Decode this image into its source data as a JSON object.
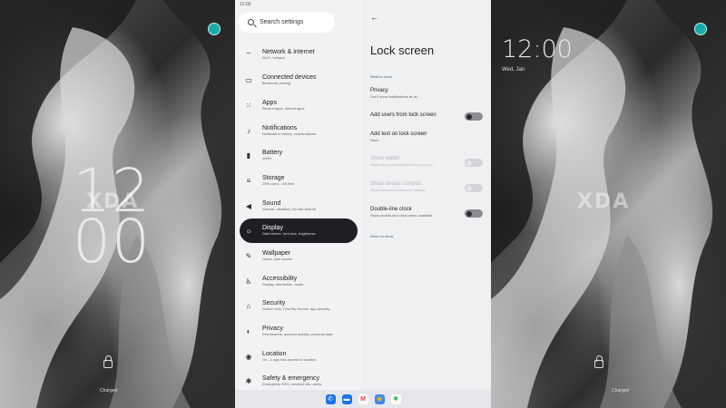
{
  "left_panel": {
    "clock_hours": "12",
    "clock_minutes": "00",
    "watermark": "XDA"
  },
  "right_panel": {
    "clock": "12:00",
    "date": "Wed, Jan",
    "watermark": "XDA",
    "status": "Charged"
  },
  "status_bar": {
    "time": "12:00"
  },
  "search": {
    "placeholder": "Search settings"
  },
  "settings_items": [
    {
      "icon": "wifi-icon",
      "title": "Network & internet",
      "subtitle": "Wi-Fi, hotspot"
    },
    {
      "icon": "devices-icon",
      "title": "Connected devices",
      "subtitle": "Bluetooth, pairing"
    },
    {
      "icon": "apps-icon",
      "title": "Apps",
      "subtitle": "Recent apps, default apps"
    },
    {
      "icon": "bell-icon",
      "title": "Notifications",
      "subtitle": "Notification history, conversations"
    },
    {
      "icon": "battery-icon",
      "title": "Battery",
      "subtitle": "100%"
    },
    {
      "icon": "storage-icon",
      "title": "Storage",
      "subtitle": "25% used - GB free"
    },
    {
      "icon": "sound-icon",
      "title": "Sound",
      "subtitle": "Volume, vibration, Do Not Disturb"
    },
    {
      "icon": "display-icon",
      "title": "Display",
      "subtitle": "Dark theme, font size, brightness"
    },
    {
      "icon": "wallpaper-icon",
      "title": "Wallpaper",
      "subtitle": "Home, lock screen"
    },
    {
      "icon": "accessibility-icon",
      "title": "Accessibility",
      "subtitle": "Display, interaction, audio"
    },
    {
      "icon": "lock-icon",
      "title": "Security",
      "subtitle": "Screen lock, Find My Device, app security"
    },
    {
      "icon": "privacy-icon",
      "title": "Privacy",
      "subtitle": "Permissions, account activity, personal data"
    },
    {
      "icon": "location-icon",
      "title": "Location",
      "subtitle": "On - 1 app has access to location"
    },
    {
      "icon": "asterisk-icon",
      "title": "Safety & emergency",
      "subtitle": "Emergency SOS, medical info, alerts"
    }
  ],
  "active_item": "Display",
  "lock_screen": {
    "title": "Lock screen",
    "section_what": "What to show",
    "section_when": "When to show",
    "prefs": [
      {
        "title": "Privacy",
        "subtitle": "Don't show notifications at all",
        "toggle": null,
        "disabled": false
      },
      {
        "title": "Add users from lock screen",
        "subtitle": "",
        "toggle": "off",
        "disabled": false
      },
      {
        "title": "Add text on lock screen",
        "subtitle": "None",
        "toggle": null,
        "disabled": false
      },
      {
        "title": "Show wallet",
        "subtitle": "Allow access to wallet from lock screen",
        "toggle": "off",
        "disabled": true
      },
      {
        "title": "Show device controls",
        "subtitle": "Show controls for external devices",
        "toggle": "off",
        "disabled": true
      },
      {
        "title": "Double-line clock",
        "subtitle": "Show double-line clock when available",
        "toggle": "off",
        "disabled": false
      }
    ]
  },
  "taskbar_apps": [
    {
      "name": "phone-icon",
      "color": "#1a73e8",
      "glyph": "✆"
    },
    {
      "name": "messages-icon",
      "color": "#1a73e8",
      "glyph": "▬"
    },
    {
      "name": "gmail-icon",
      "color": "#ea4335",
      "glyph": "M"
    },
    {
      "name": "chrome-icon",
      "color": "#fbbc05",
      "glyph": "◉"
    },
    {
      "name": "photos-icon",
      "color": "#34a853",
      "glyph": "✱"
    }
  ]
}
